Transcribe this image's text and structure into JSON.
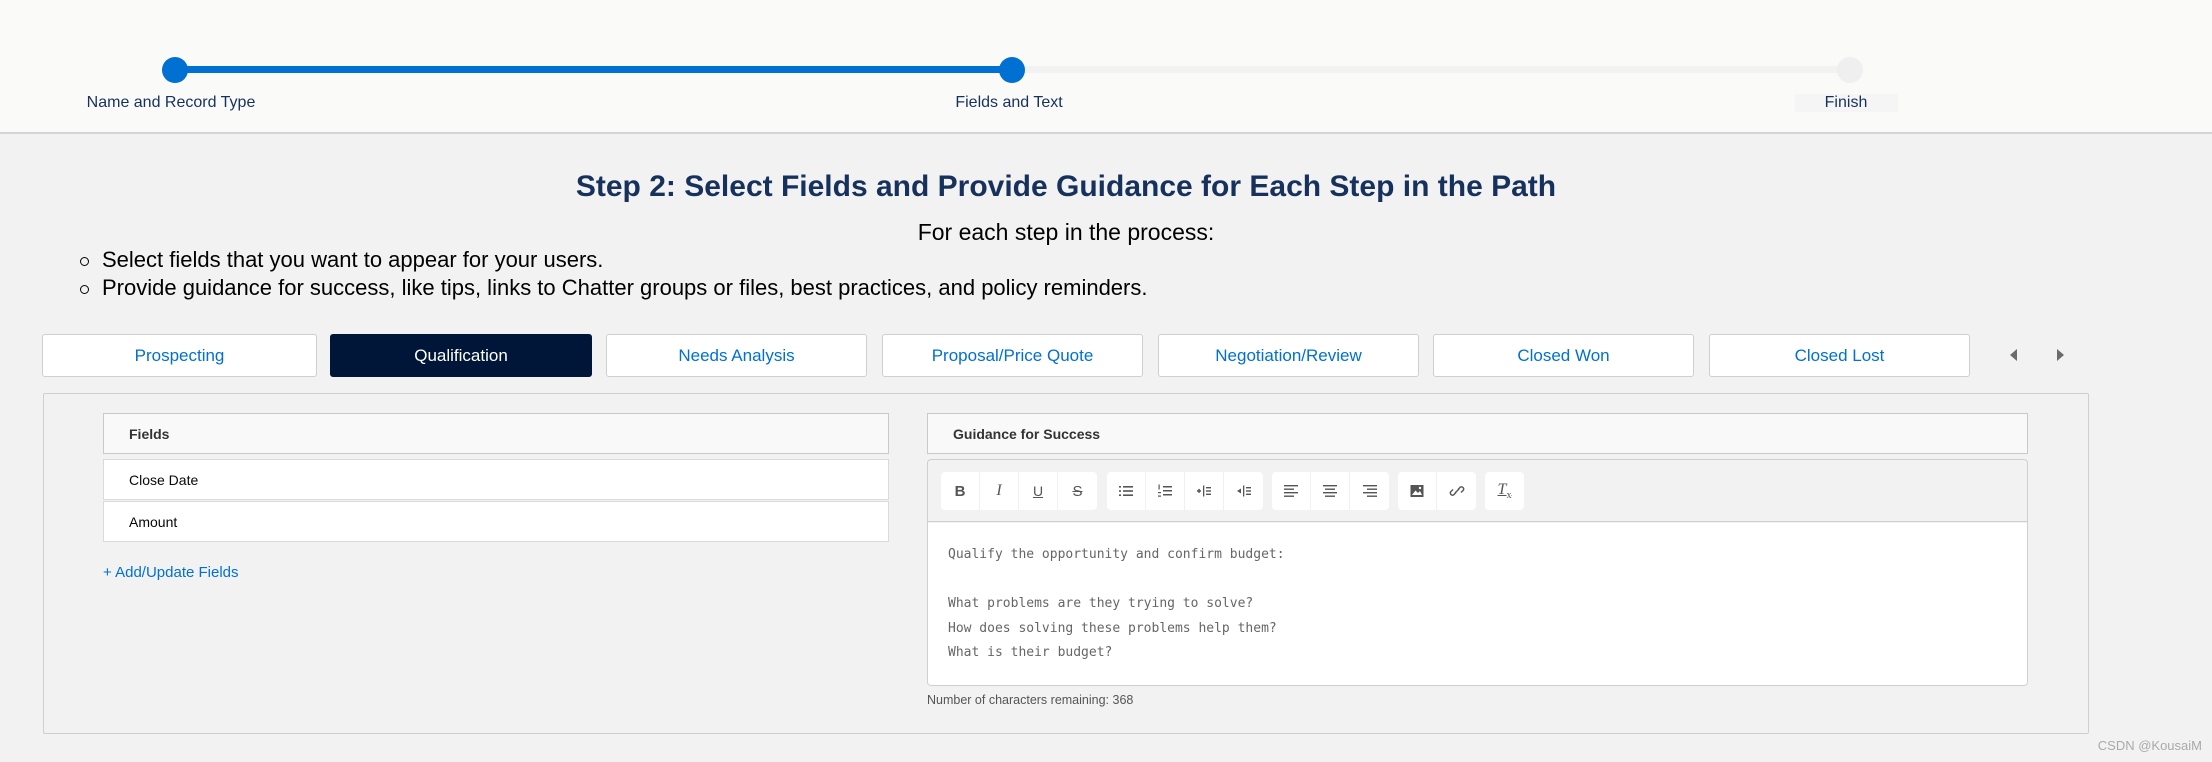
{
  "progress": {
    "steps": [
      {
        "label": "Name and Record Type",
        "state": "complete"
      },
      {
        "label": "Fields and Text",
        "state": "current"
      },
      {
        "label": "Finish",
        "state": "incomplete"
      }
    ],
    "accent_color": "#0070d2"
  },
  "intro": {
    "title": "Step 2: Select Fields and Provide Guidance for Each Step in the Path",
    "subtitle": "For each step in the process:",
    "bullets": [
      "Select fields that you want to appear for your users.",
      "Provide guidance for success, like tips, links to Chatter groups or files, best practices, and policy reminders."
    ]
  },
  "stage_tabs": {
    "items": [
      {
        "label": "Prospecting",
        "active": false
      },
      {
        "label": "Qualification",
        "active": true
      },
      {
        "label": "Needs Analysis",
        "active": false
      },
      {
        "label": "Proposal/Price Quote",
        "active": false
      },
      {
        "label": "Negotiation/Review",
        "active": false
      },
      {
        "label": "Closed Won",
        "active": false
      },
      {
        "label": "Closed Lost",
        "active": false
      }
    ],
    "prev_icon": "caret-left-icon",
    "next_icon": "caret-right-icon",
    "active_color": "#001639"
  },
  "fields_section": {
    "header": "Fields",
    "rows": [
      "Close Date",
      "Amount"
    ],
    "add_link": "+ Add/Update Fields"
  },
  "guidance_section": {
    "header": "Guidance for Success",
    "toolbar": {
      "groups": [
        [
          {
            "icon": "bold-icon",
            "glyph": "B"
          },
          {
            "icon": "italic-icon",
            "glyph": "I"
          },
          {
            "icon": "underline-icon",
            "glyph": "U"
          },
          {
            "icon": "strikethrough-icon",
            "glyph": "S"
          }
        ],
        [
          {
            "icon": "bulleted-list-icon"
          },
          {
            "icon": "numbered-list-icon"
          },
          {
            "icon": "indent-icon"
          },
          {
            "icon": "outdent-icon"
          }
        ],
        [
          {
            "icon": "align-left-icon"
          },
          {
            "icon": "align-center-icon"
          },
          {
            "icon": "align-right-icon"
          }
        ],
        [
          {
            "icon": "image-icon"
          },
          {
            "icon": "link-icon"
          }
        ],
        [
          {
            "icon": "clear-formatting-icon",
            "glyph": "T"
          }
        ]
      ]
    },
    "content_lines": [
      "Qualify the opportunity and confirm budget:",
      "",
      "What problems are they trying to solve?",
      "How does solving these problems help them?",
      "What is their budget?"
    ],
    "chars_remaining": "Number of characters remaining: 368"
  },
  "watermark": "CSDN @KousaiM"
}
